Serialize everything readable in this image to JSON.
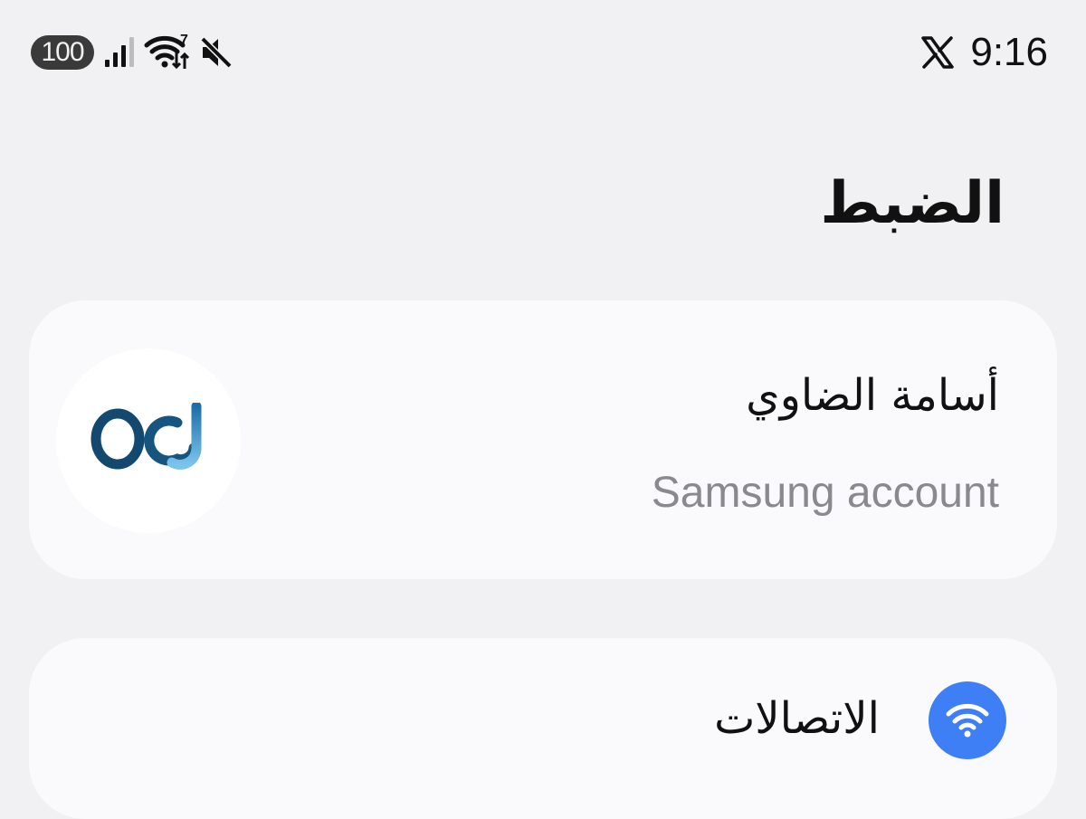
{
  "status_bar": {
    "battery_level": "100",
    "wifi_speed_indicator": "7",
    "time": "9:16",
    "icons": [
      "signal-strength-icon",
      "wifi-icon",
      "mute-icon",
      "x-app-icon"
    ]
  },
  "page": {
    "title": "الضبط"
  },
  "account": {
    "name": "أسامة الضاوي",
    "subtitle": "Samsung account",
    "avatar_icon": "od-logo-icon"
  },
  "settings": {
    "items": [
      {
        "label": "الاتصالات",
        "icon": "wifi-icon",
        "icon_color": "#3f7ff5"
      }
    ]
  },
  "colors": {
    "background": "#f1f1f3",
    "card": "#fafafc",
    "accent": "#3f7ff5",
    "secondary_text": "#8a8a8e"
  }
}
